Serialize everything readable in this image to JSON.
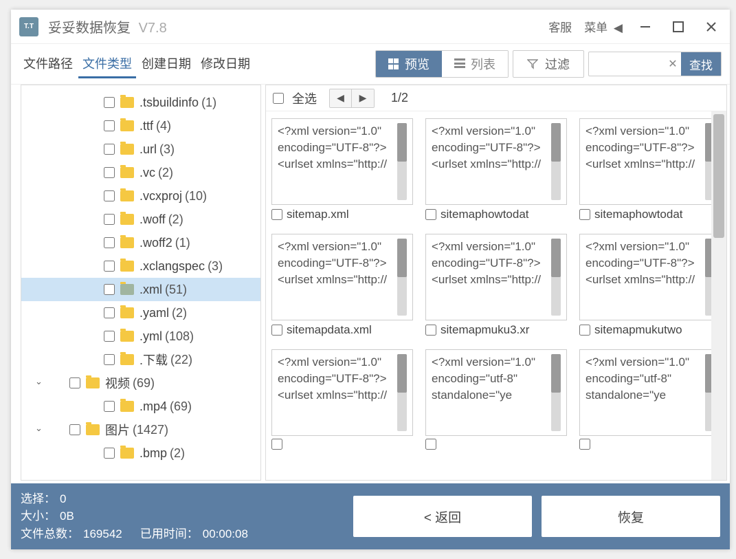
{
  "titlebar": {
    "app_name": "妥妥数据恢复",
    "version": "V7.8",
    "support": "客服",
    "menu": "菜单"
  },
  "tabs": {
    "path": "文件路径",
    "type": "文件类型",
    "created": "创建日期",
    "modified": "修改日期",
    "active": "type"
  },
  "view": {
    "preview": "预览",
    "list": "列表",
    "filter": "过滤",
    "search_btn": "查找"
  },
  "tree": [
    {
      "level": 1,
      "ext": ".tsbuildinfo",
      "count": "(1)"
    },
    {
      "level": 1,
      "ext": ".ttf",
      "count": "(4)"
    },
    {
      "level": 1,
      "ext": ".url",
      "count": "(3)"
    },
    {
      "level": 1,
      "ext": ".vc",
      "count": "(2)"
    },
    {
      "level": 1,
      "ext": ".vcxproj",
      "count": "(10)"
    },
    {
      "level": 1,
      "ext": ".woff",
      "count": "(2)"
    },
    {
      "level": 1,
      "ext": ".woff2",
      "count": "(1)"
    },
    {
      "level": 1,
      "ext": ".xclangspec",
      "count": "(3)"
    },
    {
      "level": 1,
      "ext": ".xml",
      "count": "(51)",
      "selected": true,
      "xml": true
    },
    {
      "level": 1,
      "ext": ".yaml",
      "count": "(2)"
    },
    {
      "level": 1,
      "ext": ".yml",
      "count": "(108)"
    },
    {
      "level": 1,
      "ext": ".下载",
      "count": "(22)"
    },
    {
      "level": 0,
      "ext": "视频",
      "count": "(69)",
      "chev": true
    },
    {
      "level": 1,
      "ext": ".mp4",
      "count": "(69)"
    },
    {
      "level": 0,
      "ext": "图片",
      "count": "(1427)",
      "chev": true
    },
    {
      "level": 1,
      "ext": ".bmp",
      "count": "(2)"
    }
  ],
  "main": {
    "select_all": "全选",
    "page": "1/2",
    "preview_text_a": "<?xml version=\"1.0\" encoding=\"UTF-8\"?><urlset xmlns=\"http://",
    "preview_text_b": "<?xml version=\"1.0\" encoding=\"utf-8\" standalone=\"ye",
    "cards": [
      {
        "name": "sitemap.xml",
        "v": "a"
      },
      {
        "name": "sitemaphowtodat",
        "v": "a"
      },
      {
        "name": "sitemaphowtodat",
        "v": "a"
      },
      {
        "name": "sitemapdata.xml",
        "v": "a"
      },
      {
        "name": "sitemapmuku3.xr",
        "v": "a"
      },
      {
        "name": "sitemapmukutwo",
        "v": "a"
      },
      {
        "name": "",
        "v": "a"
      },
      {
        "name": "",
        "v": "b"
      },
      {
        "name": "",
        "v": "b"
      }
    ]
  },
  "footer": {
    "sel_label": "选择：",
    "sel_val": "0",
    "size_label": "大小：",
    "size_val": "0B",
    "total_label": "文件总数：",
    "total_val": "169542",
    "time_label": "已用时间：",
    "time_val": "00:00:08",
    "back": "< 返回",
    "recover": "恢复"
  }
}
